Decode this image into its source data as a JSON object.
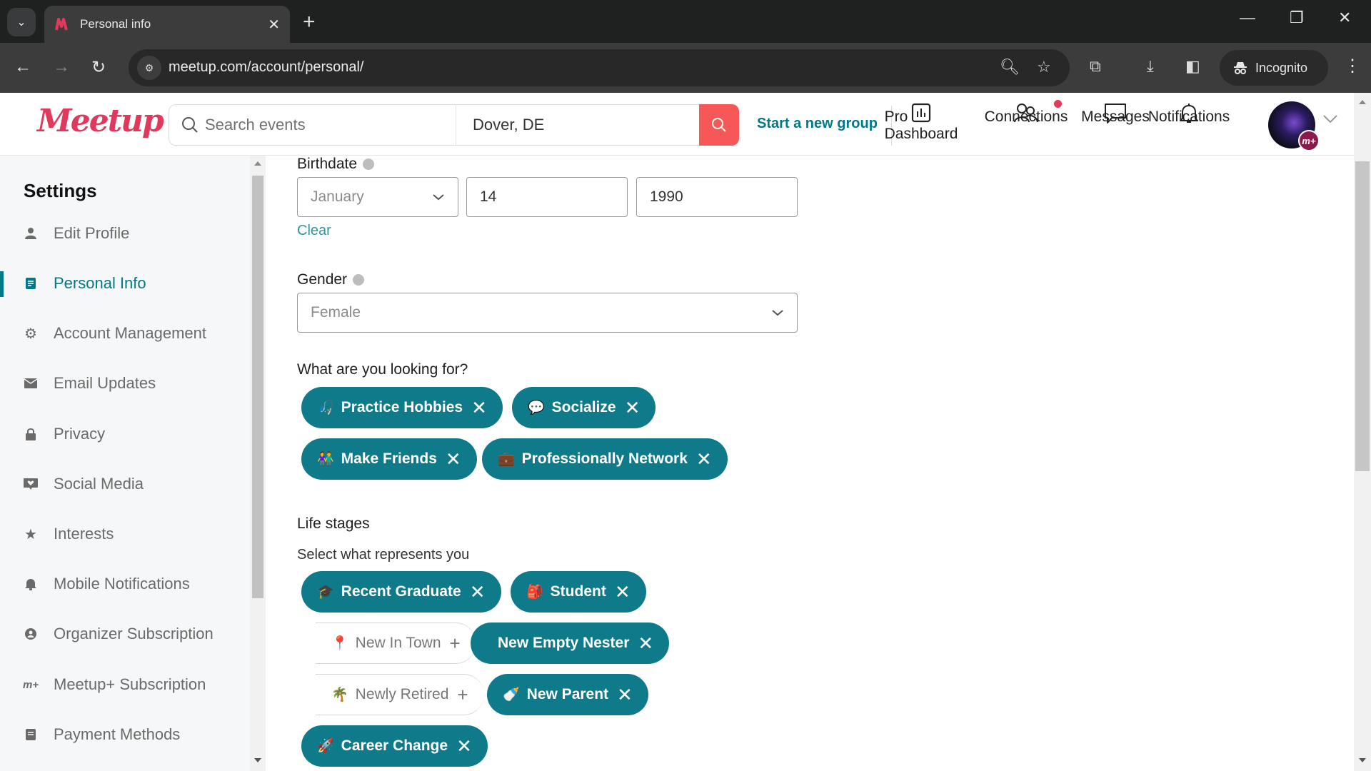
{
  "browser": {
    "tab_title": "Personal info",
    "url": "meetup.com/account/personal/",
    "profile_label": "Incognito"
  },
  "header": {
    "logo": "Meetup",
    "search_placeholder": "Search events",
    "location": "Dover, DE",
    "start_group": "Start a new group",
    "nav": [
      {
        "label": "Pro Dashboard",
        "icon": "bar-chart-icon"
      },
      {
        "label": "Connections",
        "icon": "people-icon",
        "has_badge": true
      },
      {
        "label": "Messages",
        "icon": "chat-icon"
      },
      {
        "label": "Notifications",
        "icon": "bell-icon"
      }
    ],
    "avatar_badge": "m+"
  },
  "sidebar": {
    "title": "Settings",
    "items": [
      {
        "label": "Edit Profile",
        "icon": "person-icon"
      },
      {
        "label": "Personal Info",
        "icon": "document-icon",
        "active": true
      },
      {
        "label": "Account Management",
        "icon": "gear-icon"
      },
      {
        "label": "Email Updates",
        "icon": "envelope-icon"
      },
      {
        "label": "Privacy",
        "icon": "lock-icon"
      },
      {
        "label": "Social Media",
        "icon": "heart-message-icon"
      },
      {
        "label": "Interests",
        "icon": "star-icon"
      },
      {
        "label": "Mobile Notifications",
        "icon": "bell-icon"
      },
      {
        "label": "Organizer Subscription",
        "icon": "organizer-icon"
      },
      {
        "label": "Meetup+ Subscription",
        "icon": "meetup-plus-icon"
      },
      {
        "label": "Payment Methods",
        "icon": "receipt-icon"
      }
    ]
  },
  "form": {
    "birthdate": {
      "label": "Birthdate",
      "month": "January",
      "day": "14",
      "year": "1990",
      "clear": "Clear"
    },
    "gender": {
      "label": "Gender",
      "value": "Female"
    },
    "looking_for": {
      "label": "What are you looking for?",
      "chips": [
        {
          "label": "Practice Hobbies",
          "emoji": "🎣",
          "selected": true
        },
        {
          "label": "Socialize",
          "emoji": "💬",
          "selected": true
        },
        {
          "label": "Make Friends",
          "emoji": "👫",
          "selected": true
        },
        {
          "label": "Professionally Network",
          "emoji": "💼",
          "selected": true
        }
      ]
    },
    "life_stages": {
      "label": "Life stages",
      "sublabel": "Select what represents you",
      "chips": [
        {
          "label": "Recent Graduate",
          "emoji": "🎓",
          "selected": true
        },
        {
          "label": "Student",
          "emoji": "🎒",
          "selected": true
        },
        {
          "label": "New In Town",
          "emoji": "📍",
          "selected": false
        },
        {
          "label": "New Empty Nester",
          "emoji": "",
          "selected": true
        },
        {
          "label": "Newly Retired",
          "emoji": "🌴",
          "selected": false
        },
        {
          "label": "New Parent",
          "emoji": "🍼",
          "selected": true
        },
        {
          "label": "Career Change",
          "emoji": "🚀",
          "selected": true
        }
      ]
    }
  },
  "colors": {
    "brand": "#e0395b",
    "accent": "#00798a",
    "chip": "#0f7b8a",
    "search_button": "#f65858"
  }
}
